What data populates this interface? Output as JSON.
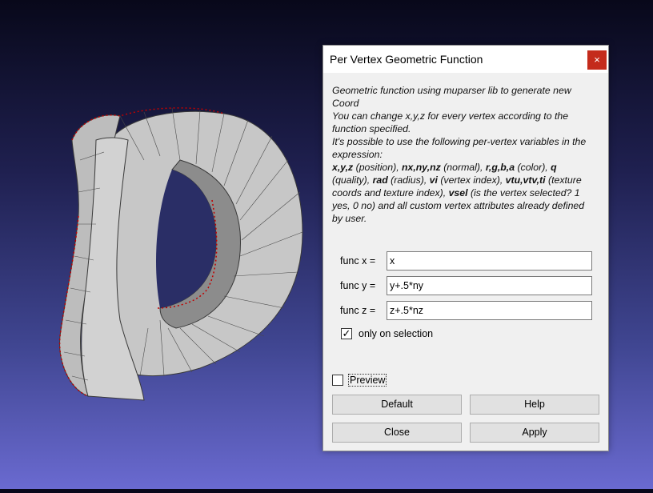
{
  "colors": {
    "background_top": "#08081a",
    "background_bottom": "#6a6ad0",
    "mesh_face": "#c7c7c7",
    "mesh_inner": "#8c8c8c",
    "mesh_edge": "#3a3a3a",
    "selection": "#c00000",
    "close_button": "#c42b1c"
  },
  "viewport": {
    "model_icon": "mesh-letter-d-icon"
  },
  "dialog": {
    "title": "Per Vertex Geometric Function",
    "close_icon": "×",
    "description": {
      "line1": "Geometric function using muparser lib to generate new Coord",
      "line2": "You can change x,y,z for every vertex according to the function specified.",
      "line3": "It's possible to use the following per-vertex variables in the expression:",
      "vars": [
        {
          "name": "x,y,z",
          "desc": " (position), "
        },
        {
          "name": "nx,ny,nz",
          "desc": " (normal), "
        },
        {
          "name": "r,g,b,a",
          "desc": " (color), "
        },
        {
          "name": "q",
          "desc": " (quality), "
        },
        {
          "name": "rad",
          "desc": " (radius), "
        },
        {
          "name": "vi",
          "desc": " (vertex index), "
        },
        {
          "name": "vtu,vtv,ti",
          "desc": " (texture coords and texture index), "
        },
        {
          "name": "vsel",
          "desc": " (is the vertex selected? 1 yes, 0 no) and all custom vertex attributes already defined by user."
        }
      ]
    },
    "func_x": {
      "label": "func x =",
      "value": "x"
    },
    "func_y": {
      "label": "func y =",
      "value": "y+.5*ny"
    },
    "func_z": {
      "label": "func z =",
      "value": "z+.5*nz"
    },
    "only_on_selection": {
      "label": "only on selection",
      "checked": true,
      "mark": "✓"
    },
    "preview": {
      "label": "Preview",
      "checked": false
    },
    "buttons": {
      "default": "Default",
      "help": "Help",
      "close": "Close",
      "apply": "Apply"
    }
  }
}
